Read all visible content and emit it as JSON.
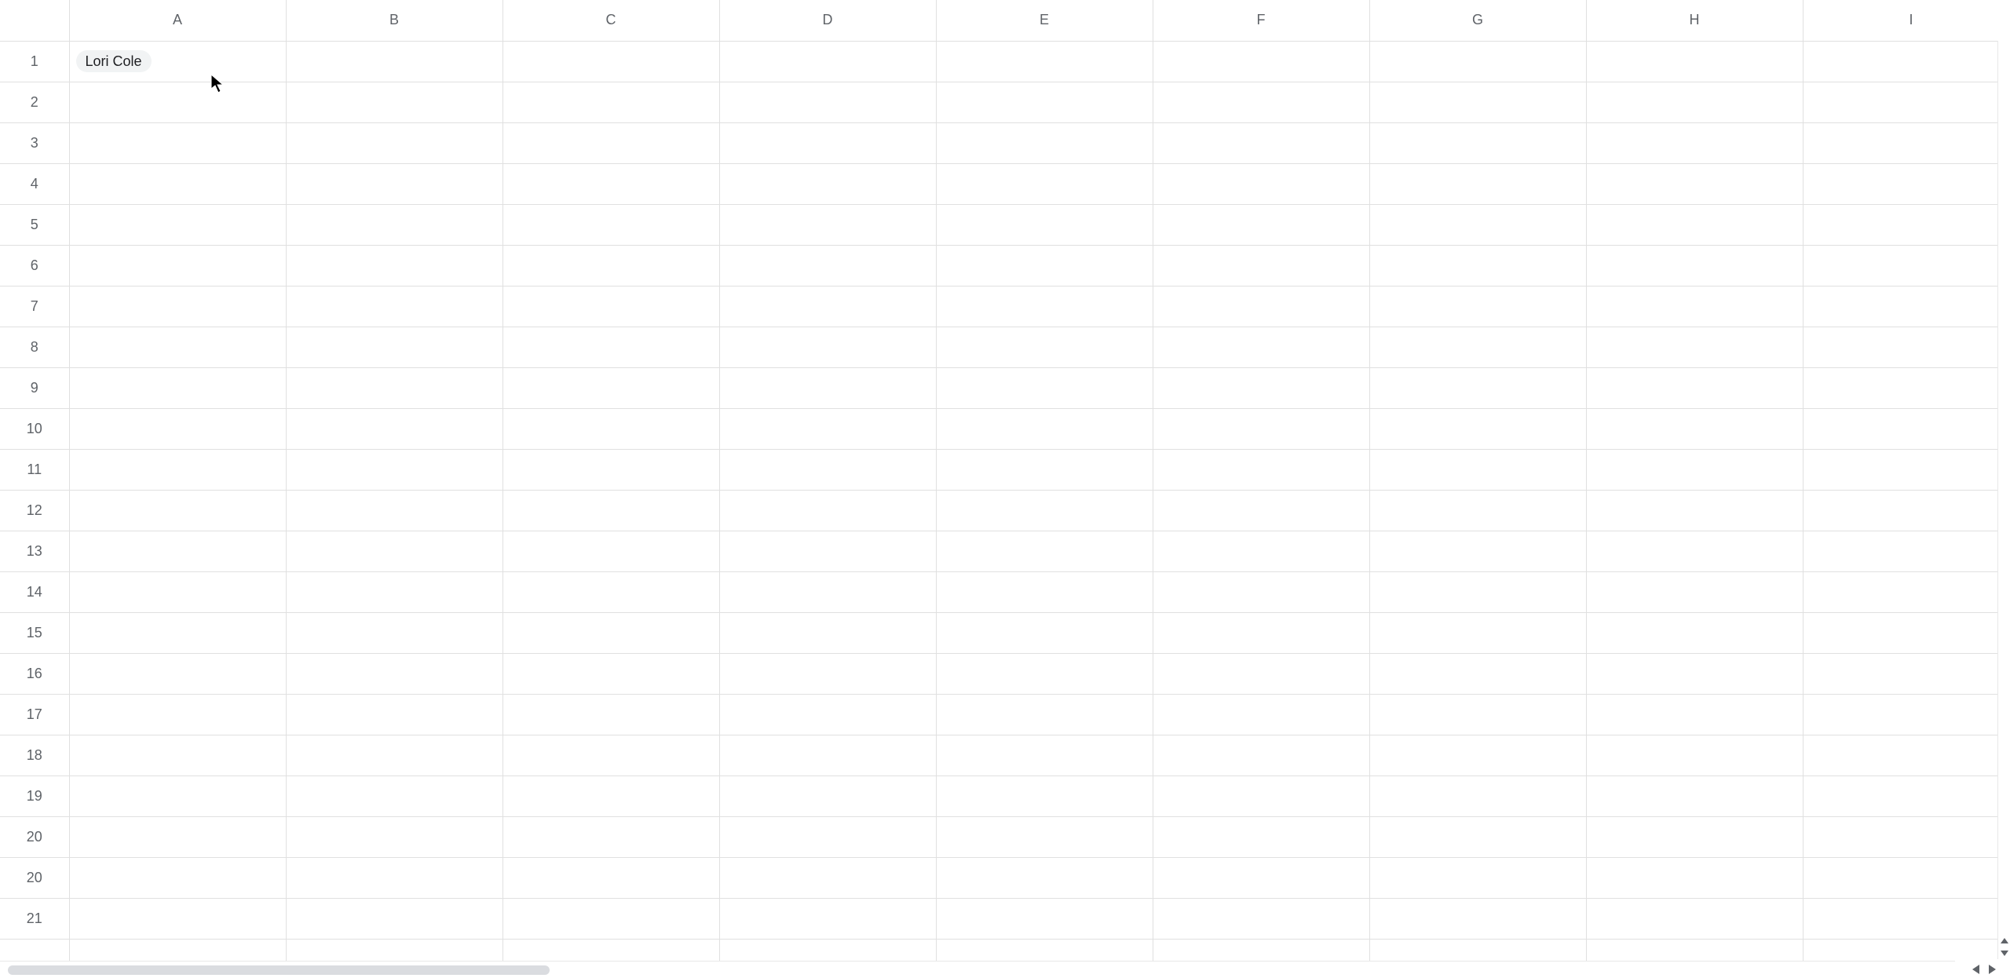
{
  "columns": [
    "A",
    "B",
    "C",
    "D",
    "E",
    "F",
    "G",
    "H",
    "I"
  ],
  "rows": [
    "1",
    "2",
    "3",
    "4",
    "5",
    "6",
    "7",
    "8",
    "9",
    "10",
    "11",
    "12",
    "13",
    "14",
    "15",
    "16",
    "17",
    "18",
    "19",
    "20",
    "20",
    "21",
    ""
  ],
  "cells": {
    "A1": {
      "chip": "Lori Cole"
    }
  }
}
